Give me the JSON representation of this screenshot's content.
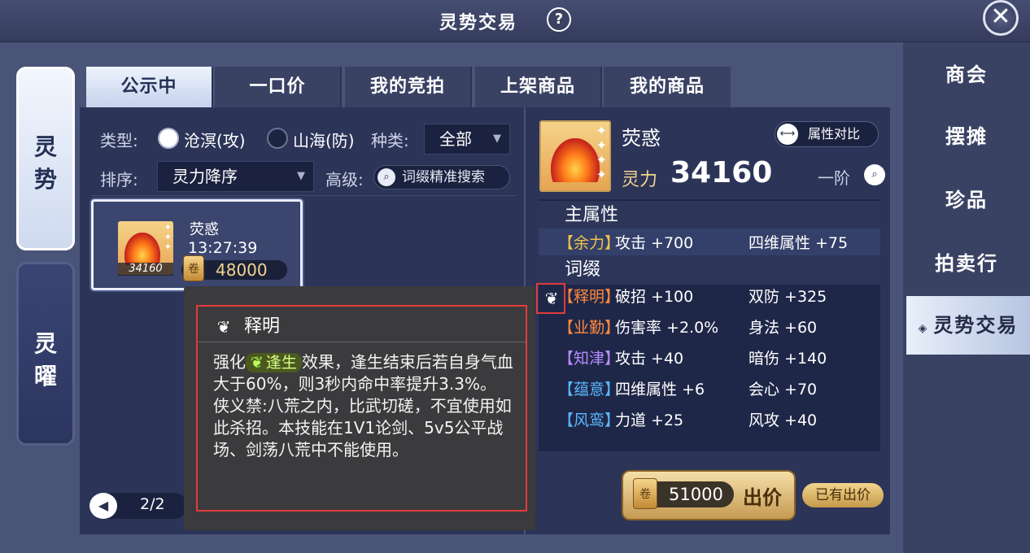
{
  "window": {
    "title": "灵势交易"
  },
  "right_menu": [
    {
      "label": "商会"
    },
    {
      "label": "摆摊"
    },
    {
      "label": "珍品"
    },
    {
      "label": "拍卖行"
    },
    {
      "label": "灵势交易"
    }
  ],
  "side_tabs": [
    {
      "label": "灵\n势"
    },
    {
      "label": "灵\n曜"
    }
  ],
  "tabs": [
    {
      "label": "公示中"
    },
    {
      "label": "一口价"
    },
    {
      "label": "我的竞拍"
    },
    {
      "label": "上架商品"
    },
    {
      "label": "我的商品"
    }
  ],
  "filters": {
    "type_label": "类型:",
    "type_opt1": "沧溟(攻)",
    "type_opt2": "山海(防)",
    "kind_label": "种类:",
    "kind_value": "全部",
    "sort_label": "排序:",
    "sort_value": "灵力降序",
    "advanced_label": "高级:",
    "search_label": "词缀精准搜索"
  },
  "item_card": {
    "name": "荧惑",
    "time": "13:27:39",
    "power": "34160",
    "price": "48000"
  },
  "pager": {
    "text": "2/2"
  },
  "tooltip": {
    "title": "释明",
    "line_pre": "强化",
    "buff": "逢生",
    "line_post": "效果，逢生结束后若自身气血大于60%，则3秒内命中率提升3.3%。",
    "line2": "侠义禁:八荒之内，比武切磋，不宜使用如此杀招。本技能在1V1论剑、5v5公平战场、剑荡八荒中不能使用。"
  },
  "detail": {
    "name": "荧惑",
    "power_label": "灵力",
    "power": "34160",
    "compare": "属性对比",
    "grade": "一阶",
    "main_head": "主属性",
    "affix_head": "词缀",
    "main_rows": [
      {
        "tag": "【余力】",
        "a1": "攻击 +700",
        "a2": "四维属性 +75",
        "color": "#f0c24a"
      }
    ],
    "affix_rows": [
      {
        "tag": "【释明】",
        "a1": "破招 +100",
        "a2": "双防 +325",
        "color": "#ff8a3c"
      },
      {
        "tag": "【业勤】",
        "a1": "伤害率 +2.0%",
        "a2": "身法 +60",
        "color": "#ff8a3c"
      },
      {
        "tag": "【知津】",
        "a1": "攻击 +40",
        "a2": "暗伤 +140",
        "color": "#b98cff"
      },
      {
        "tag": "【蕴意】",
        "a1": "四维属性 +6",
        "a2": "会心 +70",
        "color": "#5ab8ff"
      },
      {
        "tag": "【风鸾】",
        "a1": "力道 +25",
        "a2": "风攻 +40",
        "color": "#5ab8ff"
      }
    ]
  },
  "bid": {
    "amount": "51000",
    "label": "出价",
    "status": "已有出价"
  }
}
